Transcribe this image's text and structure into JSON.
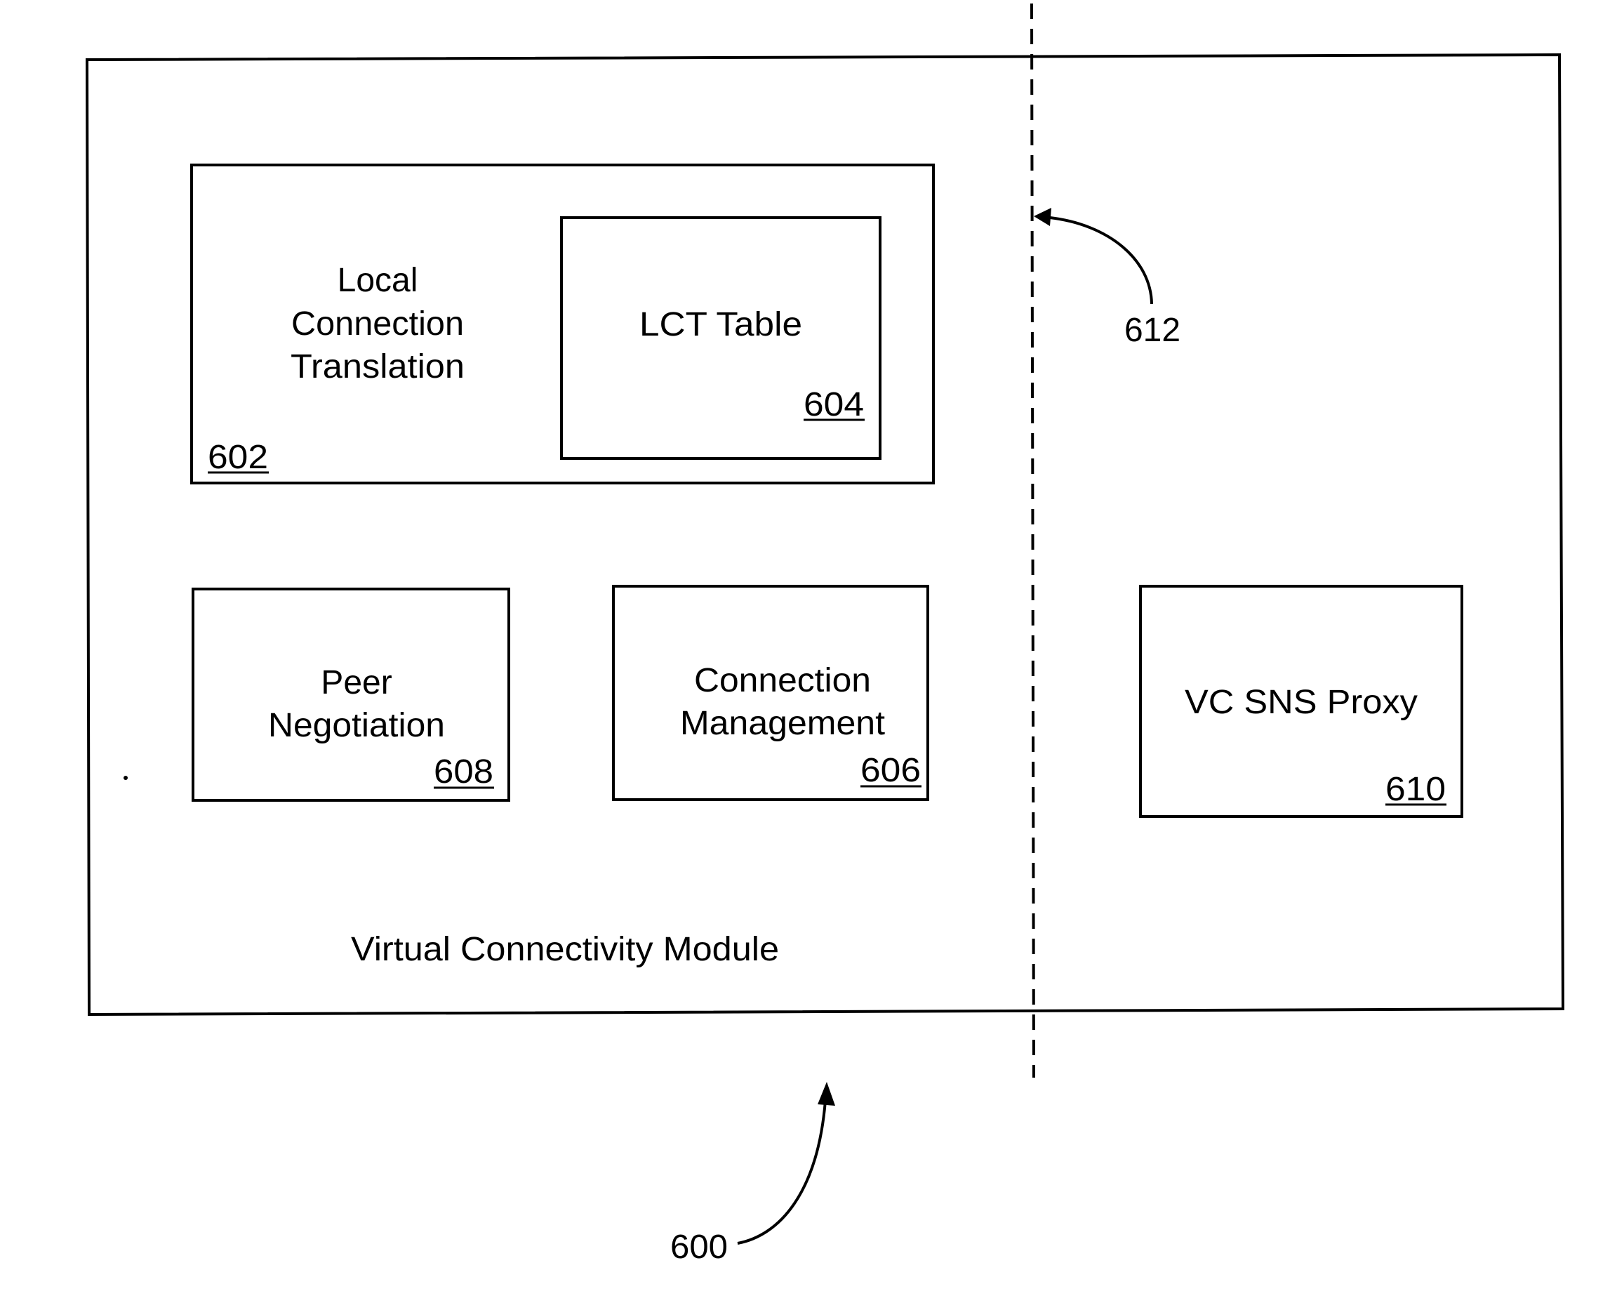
{
  "diagram": {
    "outer_module": {
      "title": "Virtual Connectivity Module",
      "ref": "600"
    },
    "boundary": {
      "ref": "612",
      "style": "dashed"
    },
    "blocks": {
      "local_connection_translation": {
        "lines": [
          "Local",
          "Connection",
          "Translation"
        ],
        "ref": "602"
      },
      "lct_table": {
        "lines": [
          "LCT Table"
        ],
        "ref": "604"
      },
      "connection_management": {
        "lines": [
          "Connection",
          "Management"
        ],
        "ref": "606"
      },
      "peer_negotiation": {
        "lines": [
          "Peer",
          "Negotiation"
        ],
        "ref": "608"
      },
      "vc_sns_proxy": {
        "lines": [
          "VC SNS Proxy"
        ],
        "ref": "610"
      }
    },
    "colors": {
      "ink": "#000000",
      "paper": "#ffffff"
    }
  }
}
